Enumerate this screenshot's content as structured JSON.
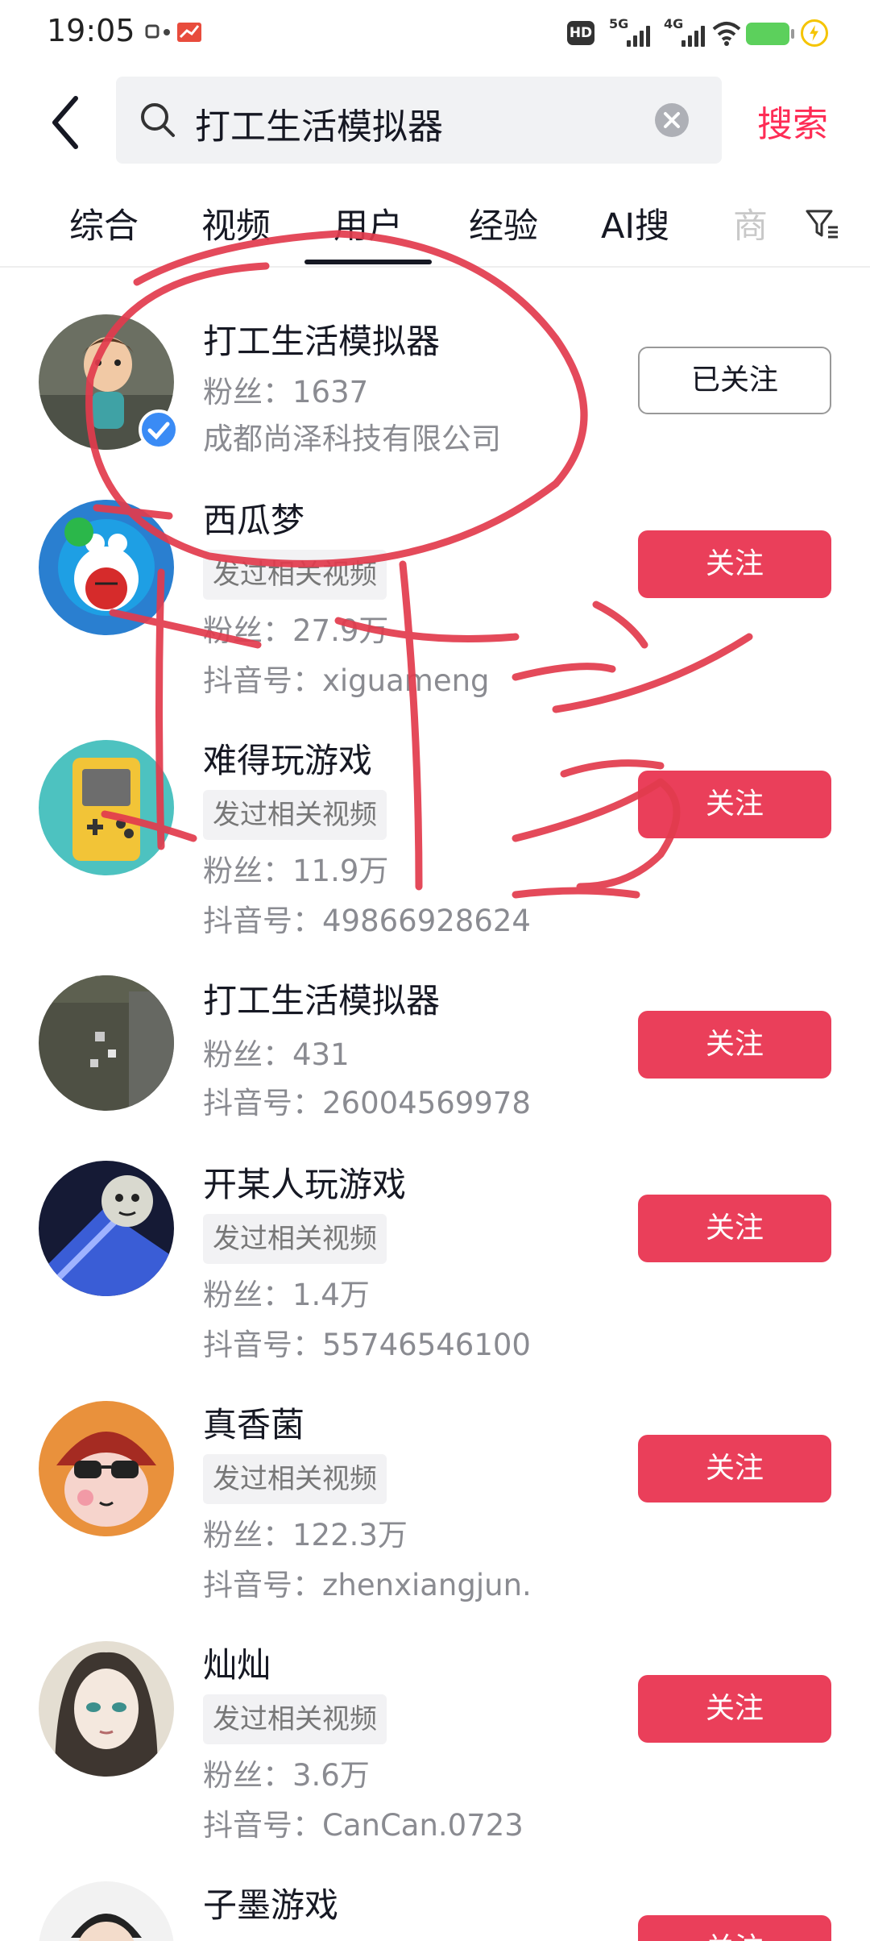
{
  "status_bar": {
    "time": "19:05",
    "hd": "HD",
    "net1": "5G",
    "net2": "4G"
  },
  "search": {
    "query": "打工生活模拟器",
    "button_label": "搜索"
  },
  "tabs": [
    {
      "label": "综合"
    },
    {
      "label": "视频"
    },
    {
      "label": "用户",
      "active": true
    },
    {
      "label": "经验"
    },
    {
      "label": "AI搜"
    },
    {
      "label": "商"
    }
  ],
  "users": [
    {
      "name": "打工生活模拟器",
      "fans": "粉丝：1637",
      "info": "成都尚泽科技有限公司",
      "button": "已关注",
      "verified": true
    },
    {
      "name": "西瓜梦",
      "tag": "发过相关视频",
      "fans": "粉丝：27.9万",
      "info": "抖音号：xiguameng",
      "button": "关注"
    },
    {
      "name": "难得玩游戏",
      "tag": "发过相关视频",
      "fans": "粉丝：11.9万",
      "info": "抖音号：49866928624",
      "button": "关注"
    },
    {
      "name": "打工生活模拟器",
      "fans": "粉丝：431",
      "info": "抖音号：26004569978",
      "button": "关注"
    },
    {
      "name": "开某人玩游戏",
      "tag": "发过相关视频",
      "fans": "粉丝：1.4万",
      "info": "抖音号：55746546100",
      "button": "关注"
    },
    {
      "name": "真香菌",
      "tag": "发过相关视频",
      "fans": "粉丝：122.3万",
      "info": "抖音号：zhenxiangjun.",
      "button": "关注"
    },
    {
      "name": "灿灿",
      "tag": "发过相关视频",
      "fans": "粉丝：3.6万",
      "info": "抖音号：CanCan.0723",
      "button": "关注"
    },
    {
      "name": "子墨游戏",
      "button": "关注"
    }
  ],
  "colors": {
    "accent": "#fe2c55",
    "follow_button": "#ea3f5a",
    "scribble": "#e23b4d"
  }
}
